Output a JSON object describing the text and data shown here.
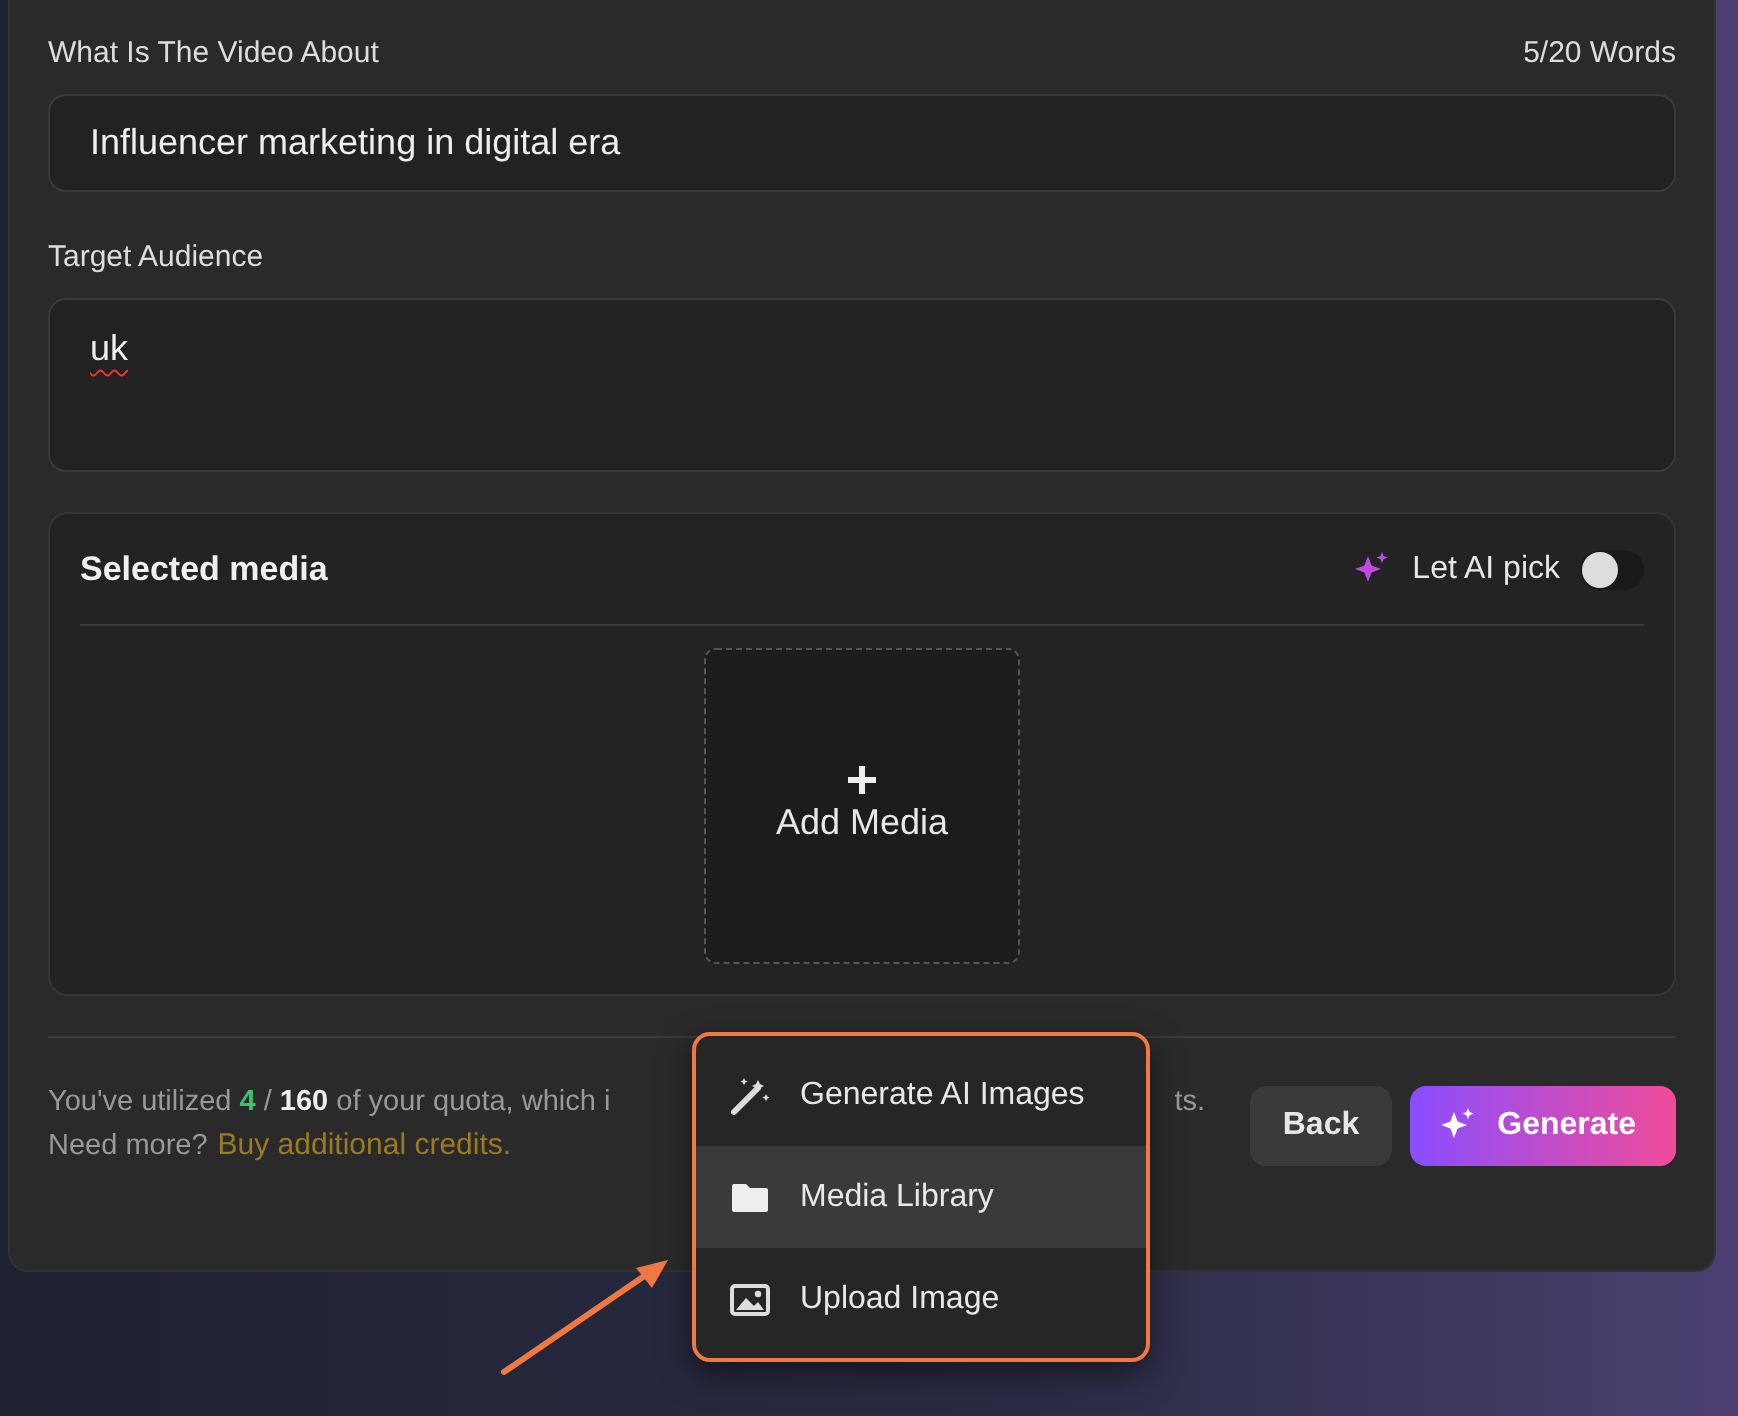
{
  "topic": {
    "label": "What Is The Video About",
    "counter": "5/20 Words",
    "value": "Influencer marketing in digital era"
  },
  "audience": {
    "label": "Target Audience",
    "value": "uk"
  },
  "media": {
    "title": "Selected media",
    "ai_pick": {
      "label": "Let AI pick",
      "on": false
    },
    "add_label": "Add Media"
  },
  "menu": [
    {
      "kind": "wand",
      "label": "Generate AI Images",
      "selected": false
    },
    {
      "kind": "folder",
      "label": "Media Library",
      "selected": true
    },
    {
      "kind": "image",
      "label": "Upload Image",
      "selected": false
    }
  ],
  "quota": {
    "text": "You've utilized **4** / **160** of your quota, which i",
    "tail": "ts.",
    "prompt": "Need more?",
    "link": "Buy additional credits."
  },
  "buttons": {
    "back": "Back",
    "generate": "Generate"
  }
}
